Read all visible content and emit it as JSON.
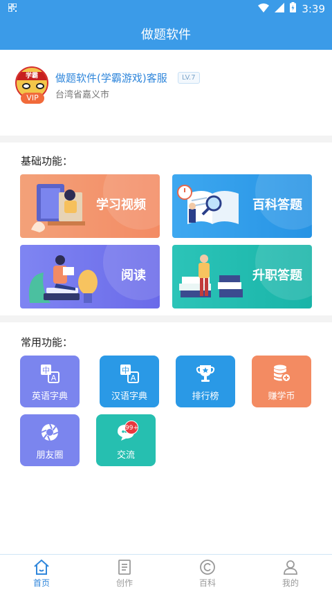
{
  "status_bar": {
    "time": "3:39",
    "left_icon": "qr-icon",
    "icons": [
      "wifi-icon",
      "signal-icon",
      "battery-charging-icon"
    ]
  },
  "header": {
    "title": "做题软件"
  },
  "profile": {
    "name": "做题软件(学霸游戏)客服",
    "level": "LV.7",
    "location": "台湾省嘉义市",
    "avatar_text": "学霸",
    "vip_badge": "VIP"
  },
  "basic": {
    "title": "基础功能：",
    "cards": [
      {
        "label": "学习视频",
        "color": "#f38b64"
      },
      {
        "label": "百科答题",
        "color": "#2693e4"
      },
      {
        "label": "阅读",
        "color": "#6a6ae9"
      },
      {
        "label": "升职答题",
        "color": "#19b4a8"
      }
    ]
  },
  "common": {
    "title": "常用功能：",
    "tiles": [
      {
        "label": "英语字典",
        "icon": "translate-icon",
        "color": "#7b85ee"
      },
      {
        "label": "汉语字典",
        "icon": "translate-icon",
        "color": "#2a99e6"
      },
      {
        "label": "排行榜",
        "icon": "trophy-icon",
        "color": "#2a99e6"
      },
      {
        "label": "赚学币",
        "icon": "coins-icon",
        "color": "#f38b62"
      },
      {
        "label": "朋友圈",
        "icon": "aperture-icon",
        "color": "#7b85ee"
      },
      {
        "label": "交流",
        "icon": "chat-icon",
        "color": "#26bfb0",
        "badge": "99+"
      }
    ]
  },
  "tabbar": {
    "tabs": [
      {
        "label": "首页",
        "icon": "home-icon",
        "active": true
      },
      {
        "label": "创作",
        "icon": "document-icon",
        "active": false
      },
      {
        "label": "百科",
        "icon": "copyright-icon",
        "active": false
      },
      {
        "label": "我的",
        "icon": "user-icon",
        "active": false
      }
    ]
  },
  "colors": {
    "primary": "#3b9be8",
    "accent_text": "#2f86db"
  }
}
